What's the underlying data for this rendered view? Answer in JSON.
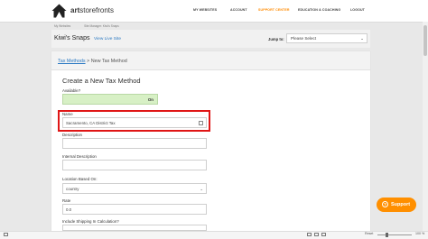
{
  "header": {
    "logo_bold": "art",
    "logo_rest": "storefronts",
    "nav": [
      {
        "label": "MY WEBSITES",
        "active": false
      },
      {
        "label": "ACCOUNT",
        "active": false
      },
      {
        "label": "SUPPORT CENTER",
        "active": true
      },
      {
        "label": "EDUCATION & COACHING",
        "active": false
      },
      {
        "label": "LOGOUT",
        "active": false
      }
    ],
    "active_color": "#ff8a00"
  },
  "breadcrumb_top": [
    "My Websites",
    "Site Manager: Kiwi's Snaps"
  ],
  "site": {
    "title": "Kiwi's Snaps",
    "view_link": "View Live Site",
    "jump_label": "Jump to:",
    "jump_value": "Please Select"
  },
  "subhead": {
    "link": "Tax Methods",
    "sep": " > ",
    "current": "New Tax Method"
  },
  "form": {
    "title": "Create a New Tax Method",
    "available_label": "Available?",
    "available_value": "On",
    "name_label": "Name",
    "name_value": "Sacramento, CA District Tax",
    "description_label": "Description",
    "internal_label": "Internal Description",
    "location_label": "Location Based On:",
    "location_value": "country",
    "rate_label": "Rate",
    "rate_value": "0.0",
    "shipping_label": "Include Shipping In Calculation?"
  },
  "support_button": "Support",
  "status": {
    "zoom_label": "Reset",
    "zoom_pct": "100 %"
  },
  "colors": {
    "accent_orange": "#ff8f00",
    "highlight_red": "#e01616",
    "link_blue": "#2b79c2",
    "toggle_green": "#d7f0c5"
  }
}
